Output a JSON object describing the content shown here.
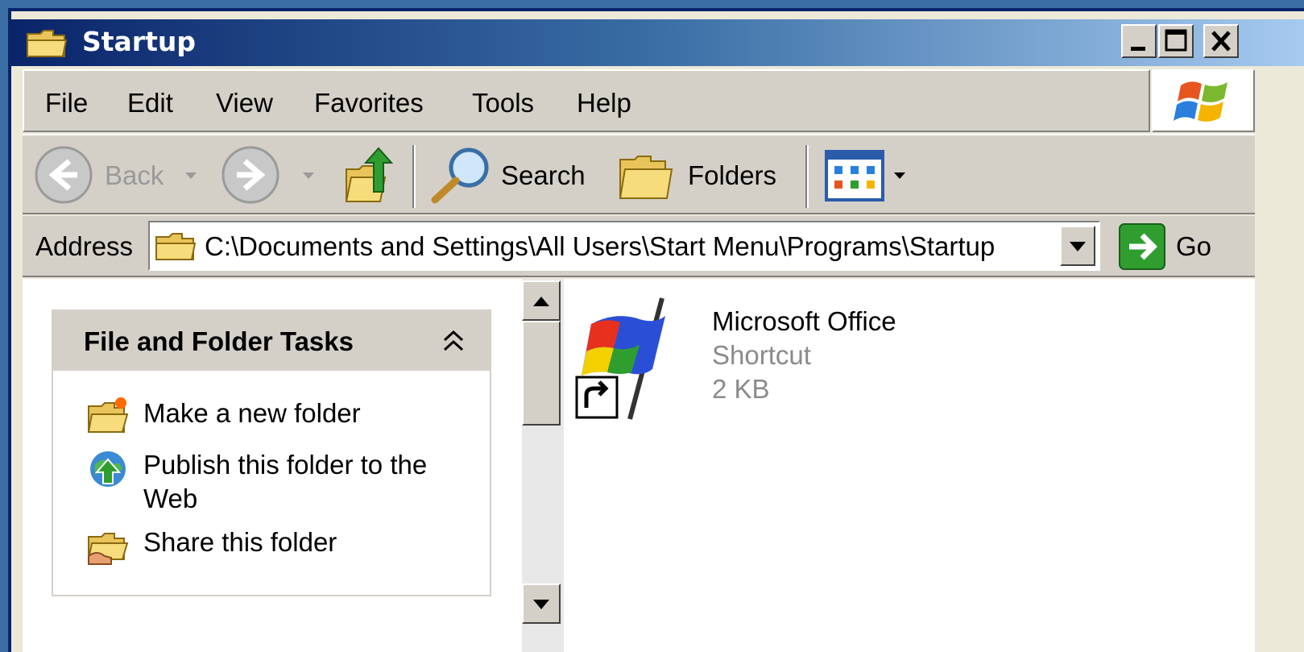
{
  "window": {
    "title": "Startup",
    "title_icon": "folder-icon"
  },
  "titlebar_buttons": [
    "minimize",
    "maximize",
    "close"
  ],
  "menu": {
    "items": [
      "File",
      "Edit",
      "View",
      "Favorites",
      "Tools",
      "Help"
    ]
  },
  "toolbar": {
    "back_label": "Back",
    "search_label": "Search",
    "folders_label": "Folders"
  },
  "address": {
    "label": "Address",
    "value": "C:\\Documents and Settings\\All Users\\Start Menu\\Programs\\Startup",
    "go_label": "Go"
  },
  "tasks": {
    "title": "File and Folder Tasks",
    "items": [
      {
        "label": "Make a new folder",
        "icon": "new-folder-icon"
      },
      {
        "label": "Publish this folder to the Web",
        "icon": "publish-web-icon"
      },
      {
        "label": "Share this folder",
        "icon": "share-folder-icon"
      }
    ]
  },
  "files": [
    {
      "name": "Microsoft Office",
      "type": "Shortcut",
      "size": "2 KB",
      "icon": "office-shortcut-icon"
    }
  ],
  "colors": {
    "titlebar_start": "#0a246a",
    "titlebar_end": "#a6caf0",
    "chrome": "#d4d0c8"
  }
}
